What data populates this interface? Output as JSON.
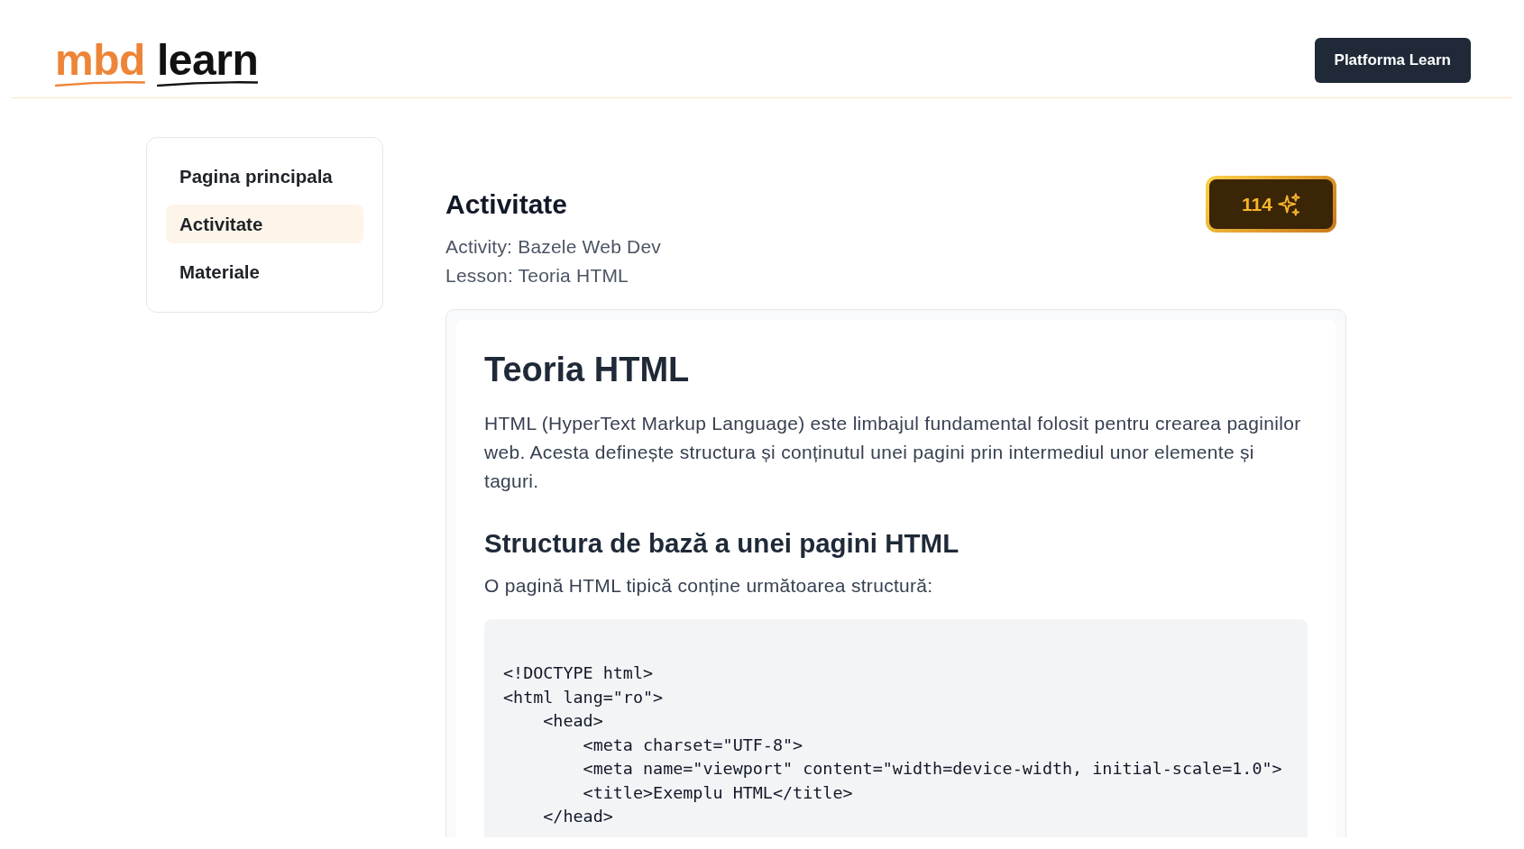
{
  "header": {
    "logo": {
      "accent_word": "mbd",
      "word": "learn"
    },
    "button": "Platforma Learn"
  },
  "sidebar": {
    "items": [
      {
        "label": "Pagina principala",
        "selected": false
      },
      {
        "label": "Activitate",
        "selected": true
      },
      {
        "label": "Materiale",
        "selected": false
      }
    ]
  },
  "main": {
    "title": "Activitate",
    "activity": "Activity: Bazele Web Dev",
    "lesson": "Lesson: Teoria HTML",
    "points_badge": "114"
  },
  "lesson_card": {
    "blocks": [
      {
        "kind": "h1",
        "text": "Teoria HTML"
      },
      {
        "kind": "paragraph",
        "text": "HTML (HyperText Markup Language) este limbajul fundamental folosit pentru crearea paginilor web. Acesta definește structura și conținutul unei pagini prin intermediul unor elemente și taguri."
      },
      {
        "kind": "h2",
        "text": "Structura de bază a unei pagini HTML"
      },
      {
        "kind": "paragraph",
        "text": "O pagină HTML tipică conține următoarea structură:"
      },
      {
        "kind": "code",
        "lines": [
          "<!DOCTYPE html>",
          "<html lang=\"ro\">",
          "    <head>",
          "        <meta charset=\"UTF-8\">",
          "        <meta name=\"viewport\" content=\"width=device-width, initial-scale=1.0\">",
          "        <title>Exemplu HTML</title>",
          "    </head>"
        ]
      }
    ]
  }
}
